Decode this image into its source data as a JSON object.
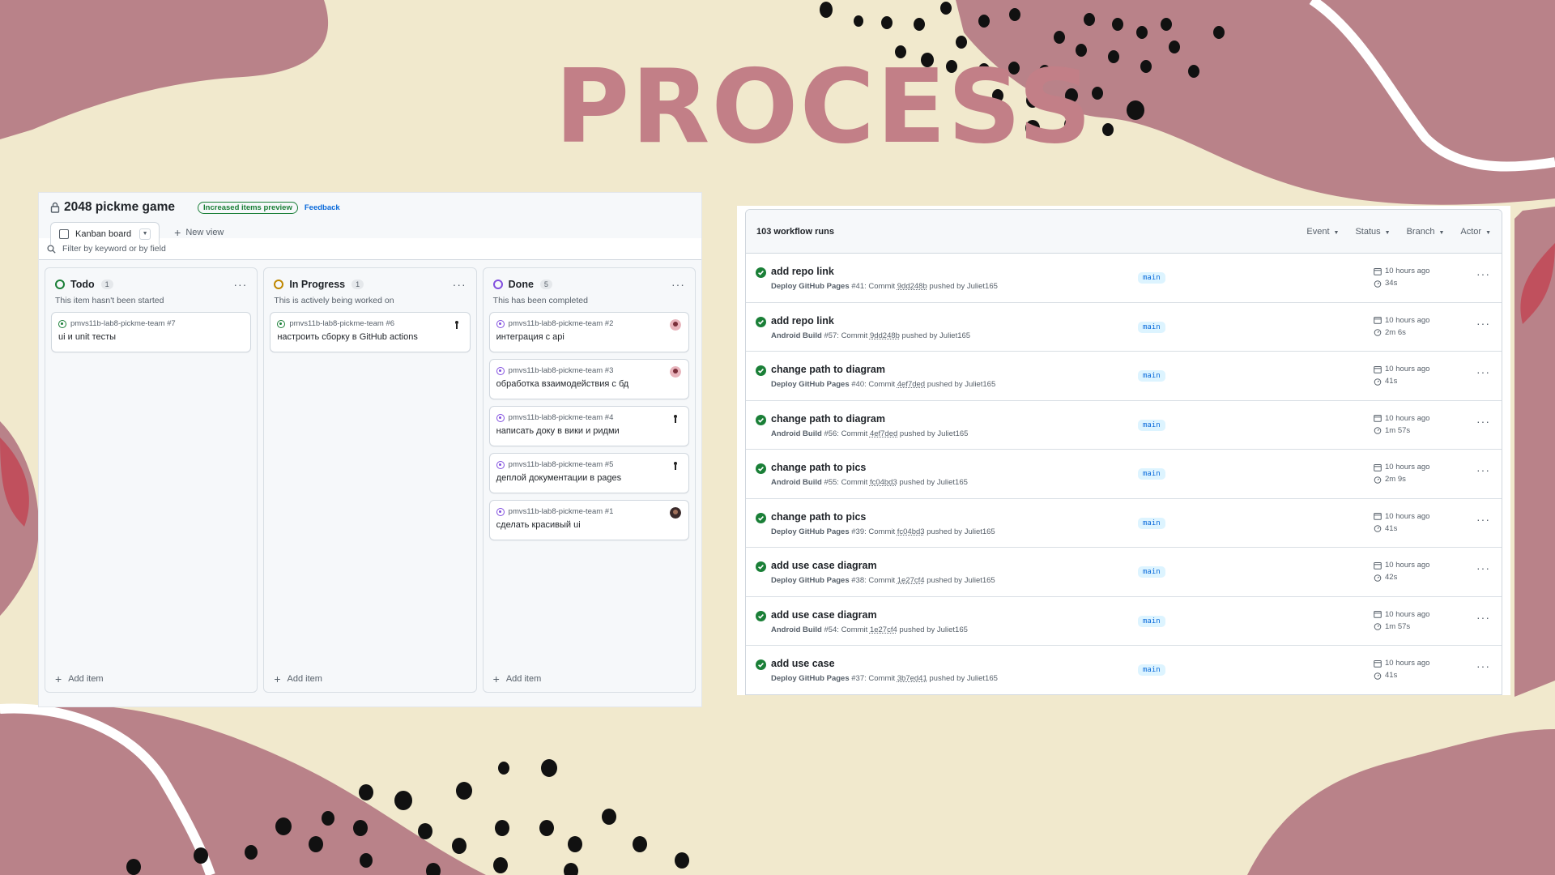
{
  "slide": {
    "title": "PROCESS"
  },
  "colors": {
    "title": "#c27f87",
    "blob": "#b98289",
    "background": "#f1e9cd",
    "green": "#1a7f37",
    "purple": "#8250df",
    "yellow": "#bf8700"
  },
  "kanban": {
    "project_title": "2048 pickme game",
    "preview_badge": "Increased items preview",
    "feedback_link": "Feedback",
    "view_tab": "Kanban board",
    "new_view": "New view",
    "filter_placeholder": "Filter by keyword or by field",
    "add_item": "Add item",
    "columns": [
      {
        "name": "Todo",
        "count": "1",
        "description": "This item hasn't been started",
        "status_color": "#1a7f37",
        "cards": [
          {
            "ref": "pmvs11b-lab8-pickme-team #7",
            "text": "ui и unit тесты",
            "icon": "open-issue-icon"
          }
        ]
      },
      {
        "name": "In Progress",
        "count": "1",
        "description": "This is actively being worked on",
        "status_color": "#bf8700",
        "cards": [
          {
            "ref": "pmvs11b-lab8-pickme-team #6",
            "text": "настроить сборку в GitHub actions",
            "icon": "open-issue-icon"
          }
        ]
      },
      {
        "name": "Done",
        "count": "5",
        "description": "This has been completed",
        "status_color": "#8250df",
        "cards": [
          {
            "ref": "pmvs11b-lab8-pickme-team #2",
            "text": "интеграция с api",
            "icon": "closed-issue-icon"
          },
          {
            "ref": "pmvs11b-lab8-pickme-team #3",
            "text": "обработка взаимодействия с бд",
            "icon": "closed-issue-icon"
          },
          {
            "ref": "pmvs11b-lab8-pickme-team #4",
            "text": "написать доку в вики и ридми",
            "icon": "closed-issue-icon"
          },
          {
            "ref": "pmvs11b-lab8-pickme-team #5",
            "text": "деплой документации в pages",
            "icon": "closed-issue-icon"
          },
          {
            "ref": "pmvs11b-lab8-pickme-team #1",
            "text": "сделать красивый ui",
            "icon": "closed-issue-icon"
          }
        ]
      }
    ]
  },
  "workflow": {
    "count_label": "103 workflow runs",
    "filters": [
      "Event",
      "Status",
      "Branch",
      "Actor"
    ],
    "runs": [
      {
        "title": "add repo link",
        "workflow": "Deploy GitHub Pages",
        "run": "#41",
        "commit": "9dd248b",
        "pusher": "Juliet165",
        "branch": "main",
        "when": "10 hours ago",
        "duration": "34s"
      },
      {
        "title": "add repo link",
        "workflow": "Android Build",
        "run": "#57",
        "commit": "9dd248b",
        "pusher": "Juliet165",
        "branch": "main",
        "when": "10 hours ago",
        "duration": "2m 6s"
      },
      {
        "title": "change path to diagram",
        "workflow": "Deploy GitHub Pages",
        "run": "#40",
        "commit": "4ef7ded",
        "pusher": "Juliet165",
        "branch": "main",
        "when": "10 hours ago",
        "duration": "41s"
      },
      {
        "title": "change path to diagram",
        "workflow": "Android Build",
        "run": "#56",
        "commit": "4ef7ded",
        "pusher": "Juliet165",
        "branch": "main",
        "when": "10 hours ago",
        "duration": "1m 57s"
      },
      {
        "title": "change path to pics",
        "workflow": "Android Build",
        "run": "#55",
        "commit": "fc04bd3",
        "pusher": "Juliet165",
        "branch": "main",
        "when": "10 hours ago",
        "duration": "2m 9s"
      },
      {
        "title": "change path to pics",
        "workflow": "Deploy GitHub Pages",
        "run": "#39",
        "commit": "fc04bd3",
        "pusher": "Juliet165",
        "branch": "main",
        "when": "10 hours ago",
        "duration": "41s"
      },
      {
        "title": "add use case diagram",
        "workflow": "Deploy GitHub Pages",
        "run": "#38",
        "commit": "1e27cf4",
        "pusher": "Juliet165",
        "branch": "main",
        "when": "10 hours ago",
        "duration": "42s"
      },
      {
        "title": "add use case diagram",
        "workflow": "Android Build",
        "run": "#54",
        "commit": "1e27cf4",
        "pusher": "Juliet165",
        "branch": "main",
        "when": "10 hours ago",
        "duration": "1m 57s"
      },
      {
        "title": "add use case",
        "workflow": "Deploy GitHub Pages",
        "run": "#37",
        "commit": "3b7ed41",
        "pusher": "Juliet165",
        "branch": "main",
        "when": "10 hours ago",
        "duration": "41s"
      }
    ]
  }
}
